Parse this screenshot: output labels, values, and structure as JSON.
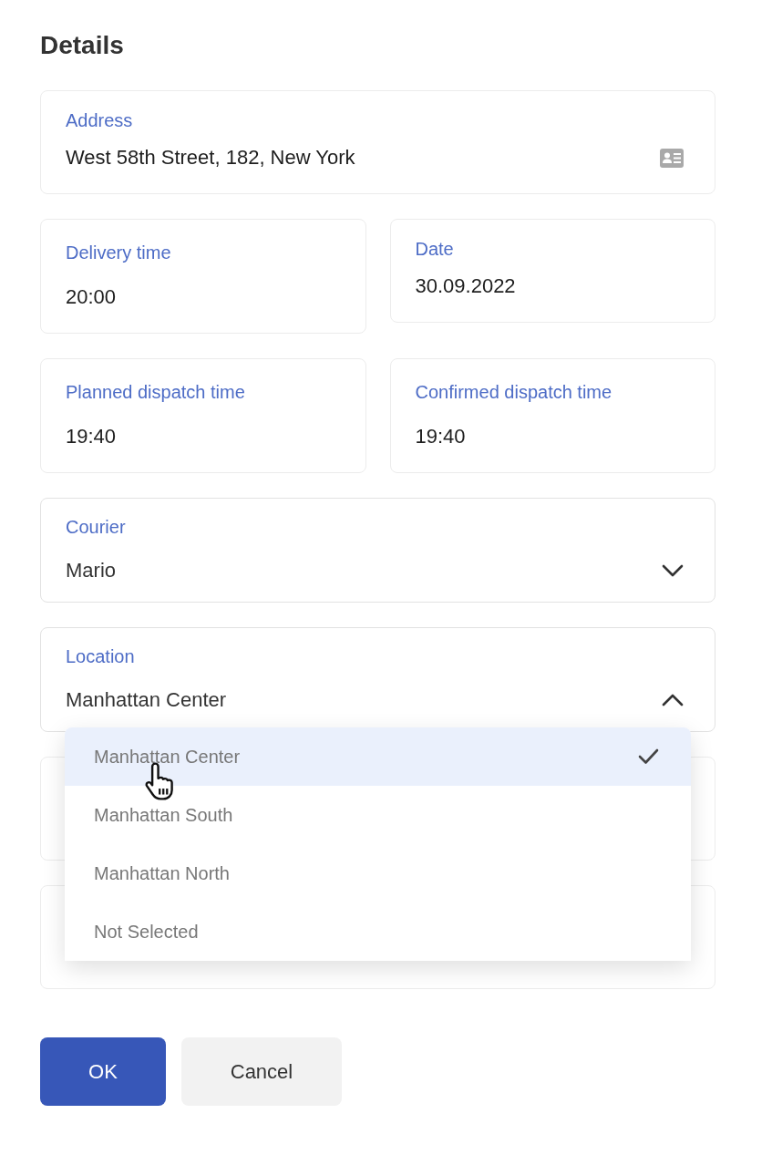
{
  "title": "Details",
  "rows": [
    [
      {
        "kind": "address",
        "label": "Address",
        "value": "West 58th Street, 182, New York"
      }
    ],
    [
      {
        "kind": "time",
        "label": "Delivery time",
        "value": "20:00"
      },
      {
        "kind": "date",
        "label": "Date",
        "value": "30.09.2022"
      }
    ],
    [
      {
        "kind": "time",
        "label": "Planned dispatch time",
        "value": "19:40"
      },
      {
        "kind": "time",
        "label": "Confirmed dispatch time",
        "value": "19:40"
      }
    ],
    [
      {
        "kind": "select",
        "label": "Courier",
        "value": "Mario",
        "expanded": false
      }
    ],
    [
      {
        "kind": "select",
        "label": "Location",
        "value": "Manhattan Center",
        "expanded": true,
        "options": [
          {
            "label": "Manhattan Center",
            "selected": true
          },
          {
            "label": "Manhattan South",
            "selected": false
          },
          {
            "label": "Manhattan North",
            "selected": false
          },
          {
            "label": "Not Selected",
            "selected": false
          }
        ]
      }
    ],
    [
      {
        "kind": "covered"
      }
    ],
    [
      {
        "kind": "covered"
      }
    ]
  ],
  "buttons": [
    {
      "kind": "primary",
      "label": "OK"
    },
    {
      "kind": "secondary",
      "label": "Cancel"
    }
  ]
}
